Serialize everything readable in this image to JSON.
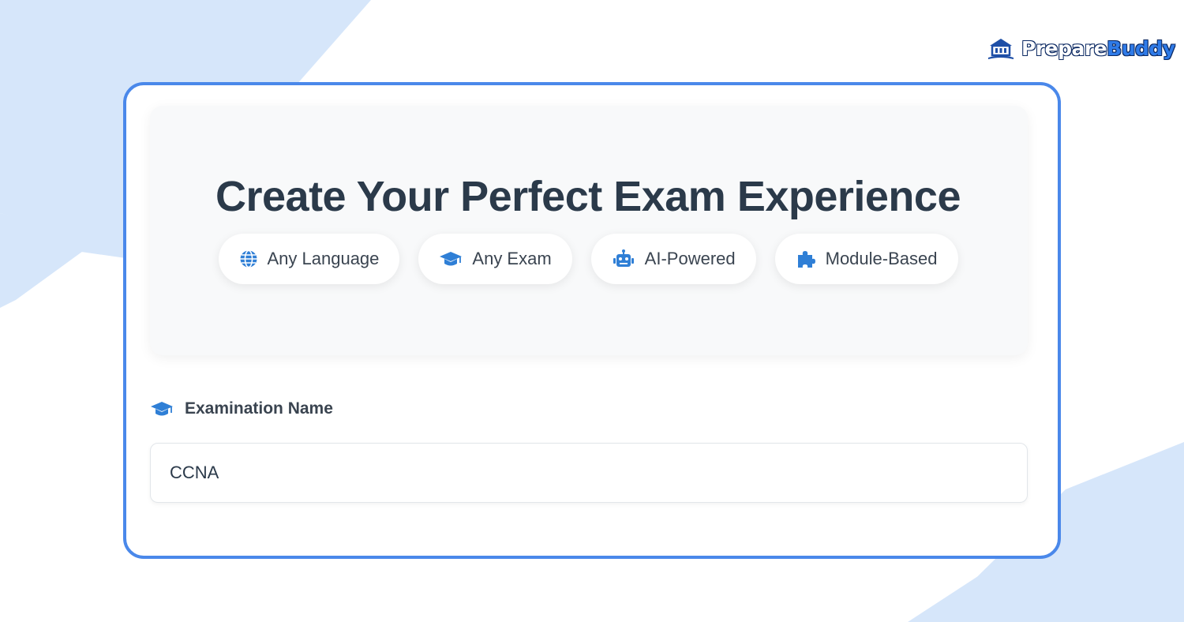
{
  "brand": {
    "logo_part1": "Prepare",
    "logo_part2": "Buddy",
    "logo_icon": "building-icon",
    "accent_color": "#4a88ea"
  },
  "hero": {
    "title": "Create Your Perfect Exam Experience",
    "features": [
      {
        "label": "Any Language",
        "icon": "globe-icon"
      },
      {
        "label": "Any Exam",
        "icon": "graduation-cap-icon"
      },
      {
        "label": "AI-Powered",
        "icon": "robot-icon"
      },
      {
        "label": "Module-Based",
        "icon": "puzzle-icon"
      }
    ]
  },
  "form": {
    "exam_name_label": "Examination Name",
    "exam_name_icon": "graduation-cap-icon",
    "exam_name_value": "CCNA"
  }
}
